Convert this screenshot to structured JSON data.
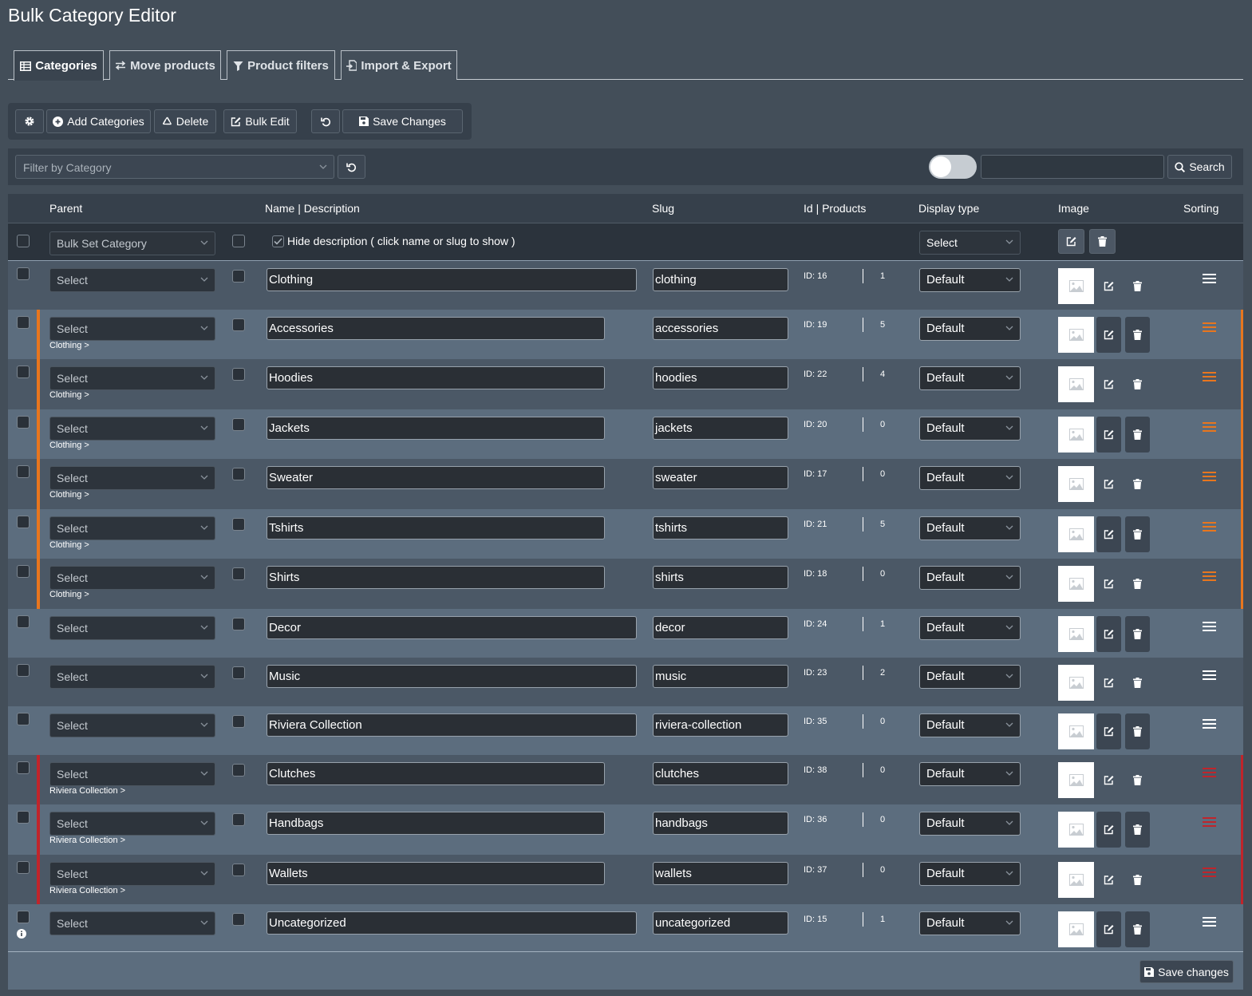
{
  "title": "Bulk Category Editor",
  "tabs": [
    {
      "label": "Categories",
      "icon": "table-icon"
    },
    {
      "label": "Move products",
      "icon": "arrows-icon"
    },
    {
      "label": "Product filters",
      "icon": "filter-icon"
    },
    {
      "label": "Import & Export",
      "icon": "file-import-icon"
    }
  ],
  "toolbar": {
    "add_label": "Add Categories",
    "delete_label": "Delete",
    "bulk_edit_label": "Bulk Edit",
    "save_label": "Save Changes"
  },
  "filter": {
    "placeholder": "Filter by Category",
    "search_label": "Search",
    "search_value": ""
  },
  "columns": {
    "parent": "Parent",
    "name": "Name | Description",
    "slug": "Slug",
    "id_products": "Id | Products",
    "display_type": "Display type",
    "image": "Image",
    "sorting": "Sorting"
  },
  "bulk": {
    "set_category": "Bulk Set Category",
    "hide_desc": "Hide description ( click name or slug to show )",
    "display_select": "Select"
  },
  "colors": {
    "orange": "#e8761e",
    "red": "#c0252b",
    "accent_toggle": "#c6ccd2"
  },
  "rows": [
    {
      "parent_select": "Select",
      "parent_label": "",
      "name": "Clothing",
      "slug": "clothing",
      "id": "ID: 16",
      "count": "1",
      "display": "Default",
      "group": "none"
    },
    {
      "parent_select": "Select",
      "parent_label": "Clothing >",
      "name": "Accessories",
      "slug": "accessories",
      "id": "ID: 19",
      "count": "5",
      "display": "Default",
      "group": "orange"
    },
    {
      "parent_select": "Select",
      "parent_label": "Clothing >",
      "name": "Hoodies",
      "slug": "hoodies",
      "id": "ID: 22",
      "count": "4",
      "display": "Default",
      "group": "orange"
    },
    {
      "parent_select": "Select",
      "parent_label": "Clothing >",
      "name": "Jackets",
      "slug": "jackets",
      "id": "ID: 20",
      "count": "0",
      "display": "Default",
      "group": "orange"
    },
    {
      "parent_select": "Select",
      "parent_label": "Clothing >",
      "name": "Sweater",
      "slug": "sweater",
      "id": "ID: 17",
      "count": "0",
      "display": "Default",
      "group": "orange"
    },
    {
      "parent_select": "Select",
      "parent_label": "Clothing >",
      "name": "Tshirts",
      "slug": "tshirts",
      "id": "ID: 21",
      "count": "5",
      "display": "Default",
      "group": "orange"
    },
    {
      "parent_select": "Select",
      "parent_label": "Clothing >",
      "name": "Shirts",
      "slug": "shirts",
      "id": "ID: 18",
      "count": "0",
      "display": "Default",
      "group": "orange"
    },
    {
      "parent_select": "Select",
      "parent_label": "",
      "name": "Decor",
      "slug": "decor",
      "id": "ID: 24",
      "count": "1",
      "display": "Default",
      "group": "none"
    },
    {
      "parent_select": "Select",
      "parent_label": "",
      "name": "Music",
      "slug": "music",
      "id": "ID: 23",
      "count": "2",
      "display": "Default",
      "group": "none"
    },
    {
      "parent_select": "Select",
      "parent_label": "",
      "name": "Riviera Collection",
      "slug": "riviera-collection",
      "id": "ID: 35",
      "count": "0",
      "display": "Default",
      "group": "none"
    },
    {
      "parent_select": "Select",
      "parent_label": "Riviera Collection >",
      "name": "Clutches",
      "slug": "clutches",
      "id": "ID: 38",
      "count": "0",
      "display": "Default",
      "group": "red"
    },
    {
      "parent_select": "Select",
      "parent_label": "Riviera Collection >",
      "name": "Handbags",
      "slug": "handbags",
      "id": "ID: 36",
      "count": "0",
      "display": "Default",
      "group": "red"
    },
    {
      "parent_select": "Select",
      "parent_label": "Riviera Collection >",
      "name": "Wallets",
      "slug": "wallets",
      "id": "ID: 37",
      "count": "0",
      "display": "Default",
      "group": "red"
    },
    {
      "parent_select": "Select",
      "parent_label": "",
      "name": "Uncategorized",
      "slug": "uncategorized",
      "id": "ID: 15",
      "count": "1",
      "display": "Default",
      "group": "none",
      "info": true
    }
  ],
  "footer": {
    "save_label": "Save changes"
  }
}
